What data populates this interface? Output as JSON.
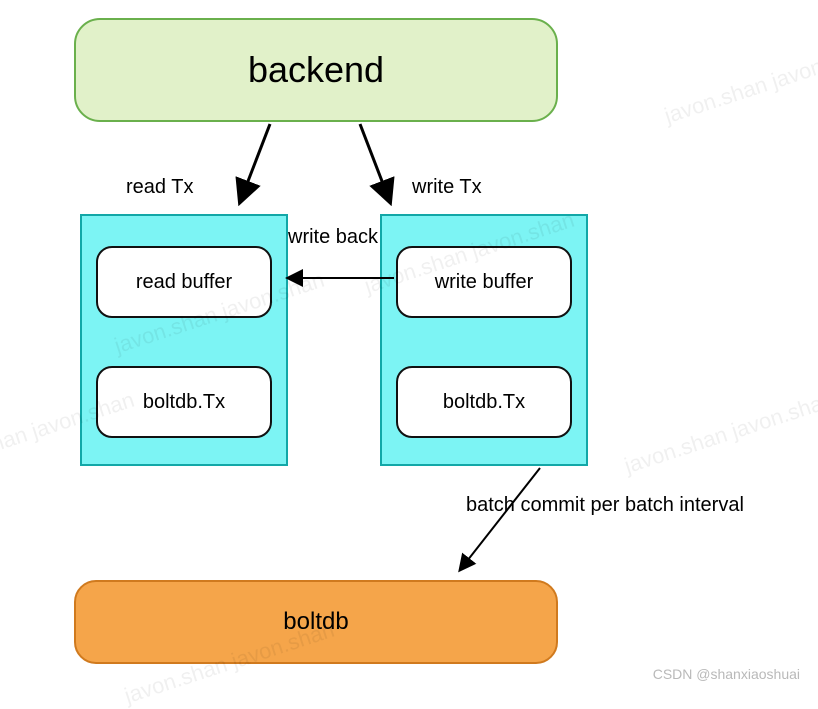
{
  "backend": {
    "label": "backend"
  },
  "edges": {
    "readTx": "read Tx",
    "writeTx": "write Tx",
    "writeBack": "write back",
    "batchCommit": "batch commit per batch interval"
  },
  "readPanel": {
    "buffer": "read buffer",
    "tx": "boltdb.Tx"
  },
  "writePanel": {
    "buffer": "write buffer",
    "tx": "boltdb.Tx"
  },
  "boltdb": {
    "label": "boltdb"
  },
  "watermark": "javon.shan javon.shan",
  "attribution": "CSDN @shanxiaoshuai"
}
